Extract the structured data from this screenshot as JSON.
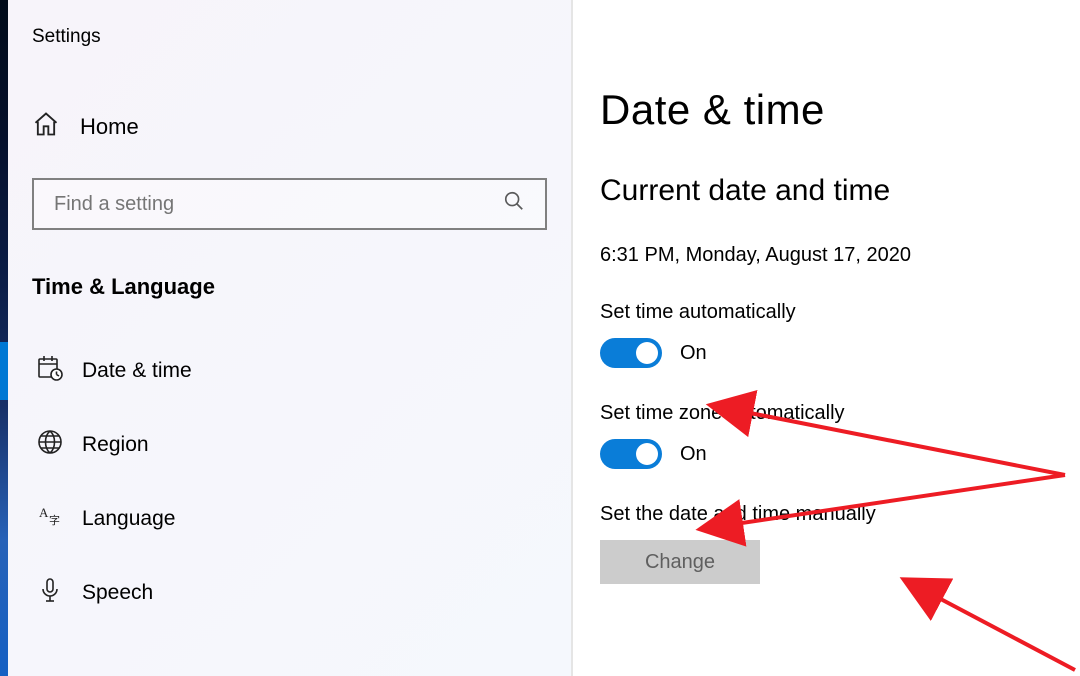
{
  "app": {
    "title": "Settings"
  },
  "sidebar": {
    "home_label": "Home",
    "search_placeholder": "Find a setting",
    "category_label": "Time & Language",
    "items": [
      {
        "label": "Date & time",
        "selected": true
      },
      {
        "label": "Region",
        "selected": false
      },
      {
        "label": "Language",
        "selected": false
      },
      {
        "label": "Speech",
        "selected": false
      }
    ]
  },
  "main": {
    "page_title": "Date & time",
    "section_current_title": "Current date and time",
    "current_datetime": "6:31 PM, Monday, August 17, 2020",
    "set_time_auto": {
      "label": "Set time automatically",
      "state": "On"
    },
    "set_tz_auto": {
      "label": "Set time zone automatically",
      "state": "On"
    },
    "manual": {
      "label": "Set the date and time manually",
      "button": "Change",
      "enabled": false
    }
  },
  "colors": {
    "accent": "#0078d4",
    "toggle": "#0a7dd8",
    "arrow": "#ed1c24"
  }
}
